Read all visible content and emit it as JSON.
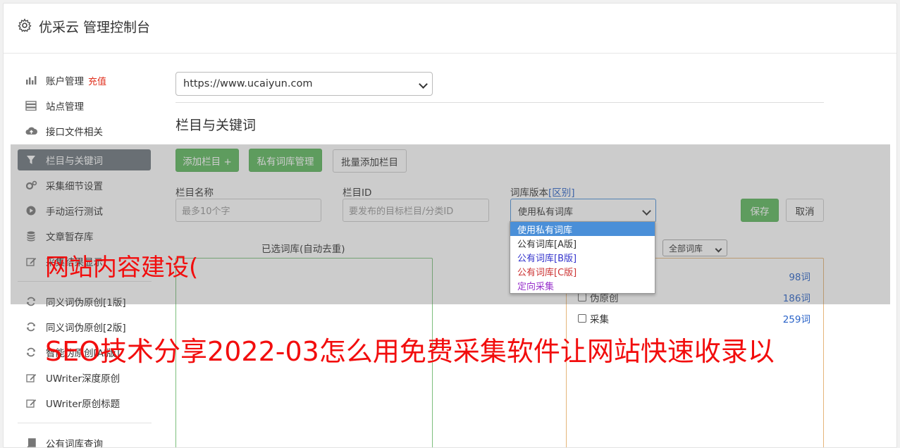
{
  "app": {
    "title": "优采云 管理控制台"
  },
  "sidebar": {
    "items": [
      {
        "label": "账户管理",
        "badge": "充值",
        "icon": "bar-chart-icon"
      },
      {
        "label": "站点管理",
        "icon": "server-icon"
      },
      {
        "label": "接口文件相关",
        "icon": "cloud-upload-icon"
      },
      {
        "label": "栏目与关键词",
        "icon": "filter-icon",
        "active": true
      },
      {
        "label": "采集细节设置",
        "icon": "cogs-icon"
      },
      {
        "label": "手动运行测试",
        "icon": "play-circle-icon"
      },
      {
        "label": "文章暂存库",
        "icon": "database-icon"
      },
      {
        "label": "采集结果显示",
        "icon": "edit-icon"
      },
      {
        "label": "同义词伪原创[1版]",
        "icon": "refresh-icon"
      },
      {
        "label": "同义词伪原创[2版]",
        "icon": "refresh-icon"
      },
      {
        "label": "智能伪原创[AI版]",
        "icon": "refresh-icon"
      },
      {
        "label": "UWriter深度原创",
        "icon": "edit-icon"
      },
      {
        "label": "UWriter原创标题",
        "icon": "edit-icon"
      },
      {
        "label": "公有词库查询",
        "icon": "book-icon"
      }
    ]
  },
  "main": {
    "site_select": {
      "value": "https://www.ucaiyun.com"
    },
    "section_title": "栏目与关键词",
    "buttons": {
      "add_column": "添加栏目 +",
      "private_lib": "私有词库管理",
      "batch_add": "批量添加栏目",
      "save": "保存",
      "cancel": "取消"
    },
    "form": {
      "column_name_label": "栏目名称",
      "column_name_placeholder": "最多10个字",
      "column_id_label": "栏目ID",
      "column_id_placeholder": "要发布的目标栏目/分类ID",
      "lib_version_label": "词库版本",
      "lib_version_dist": "[区别]",
      "lib_version_value": "使用私有词库"
    },
    "dropdown_options": [
      {
        "label": "使用私有词库",
        "color": "#ffffff",
        "selected": true
      },
      {
        "label": "公有词库[A版]",
        "color": "#333333"
      },
      {
        "label": "公有词库[B版]",
        "color": "#3333cc"
      },
      {
        "label": "公有词库[C版]",
        "color": "#cc3333"
      },
      {
        "label": "定向采集",
        "color": "#9933cc"
      }
    ],
    "selected_libs_label": "已选词库(自动去重)",
    "all_libs_select": "全部词库",
    "libs": [
      {
        "label": "",
        "count": "98词"
      },
      {
        "label": "伪原创",
        "count": "186词"
      },
      {
        "label": "采集",
        "count": "259词"
      }
    ]
  },
  "watermark": {
    "line1": "网站内容建设(",
    "line2": "SEO技术分享2022-03怎么用免费采集软件让网站快速收录以"
  }
}
